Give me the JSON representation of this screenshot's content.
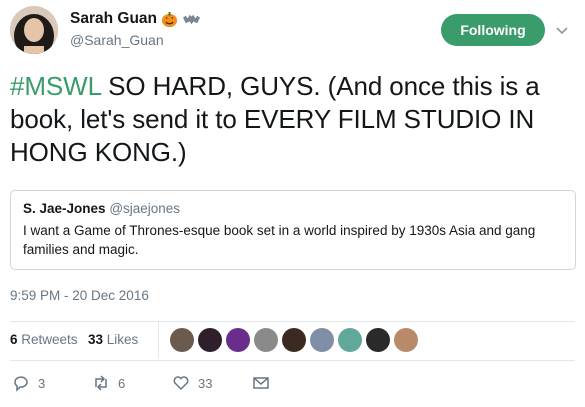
{
  "user": {
    "display_name": "Sarah Guan",
    "handle": "@Sarah_Guan"
  },
  "follow_button": {
    "label": "Following"
  },
  "tweet": {
    "hashtag": "#MSWL",
    "text": " SO HARD, GUYS. (And once this is a book, let's send it to EVERY FILM STUDIO IN HONG KONG.)"
  },
  "quoted": {
    "name": "S. Jae-Jones",
    "handle": "@sjaejones",
    "text": "I want a Game of Thrones-esque book set in a world inspired by 1930s Asia and gang families and magic."
  },
  "timestamp": "9:59 PM - 20 Dec 2016",
  "stats": {
    "retweets_count": "6",
    "retweets_label": "Retweets",
    "likes_count": "33",
    "likes_label": "Likes"
  },
  "liker_avatar_colors": [
    "#6b5a4e",
    "#2e1f2a",
    "#6a2d8c",
    "#8a8a8a",
    "#3b2a22",
    "#7f8fa6",
    "#5fa89a",
    "#2a2a2a",
    "#b88a6a"
  ],
  "actions": {
    "reply_count": "3",
    "retweet_count": "6",
    "like_count": "33"
  },
  "colors": {
    "accent": "#3a9b6b",
    "muted": "#657786"
  }
}
